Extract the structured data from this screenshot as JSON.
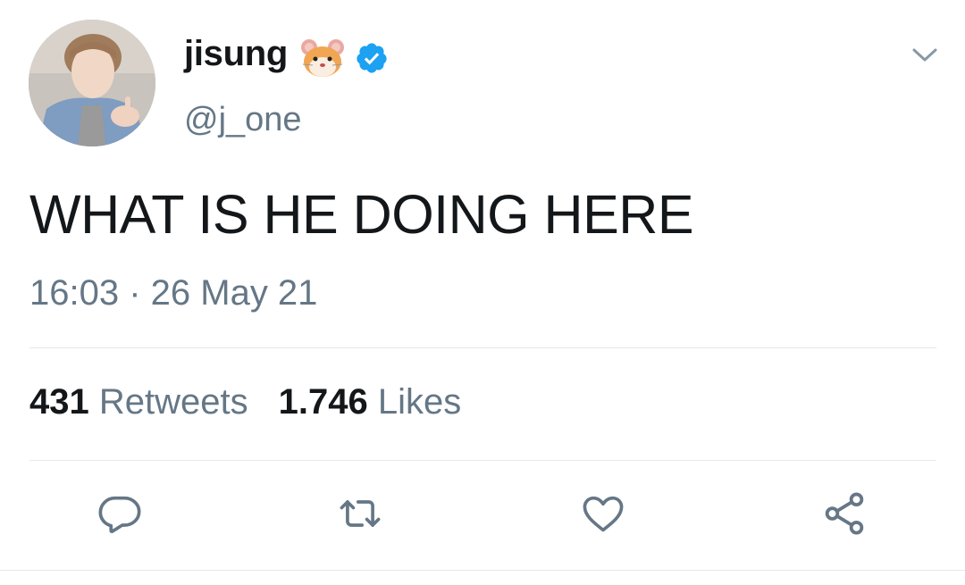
{
  "author": {
    "display_name": "jisung",
    "handle": "@j_one",
    "emoji_icon": "hamster-face-icon",
    "verified": true,
    "verified_color": "#1da1f2"
  },
  "tweet": {
    "text": "WHAT IS HE DOING HERE",
    "timestamp": "16:03 · 26 May 21"
  },
  "stats": {
    "retweets_count": "431",
    "retweets_label": "Retweets",
    "likes_count": "1.746",
    "likes_label": "Likes"
  },
  "actions": [
    "reply-icon",
    "retweet-icon",
    "like-icon",
    "share-icon"
  ],
  "colors": {
    "text_primary": "#14171a",
    "text_secondary": "#657786",
    "divider": "#e1e8ed",
    "icon": "#657786"
  }
}
